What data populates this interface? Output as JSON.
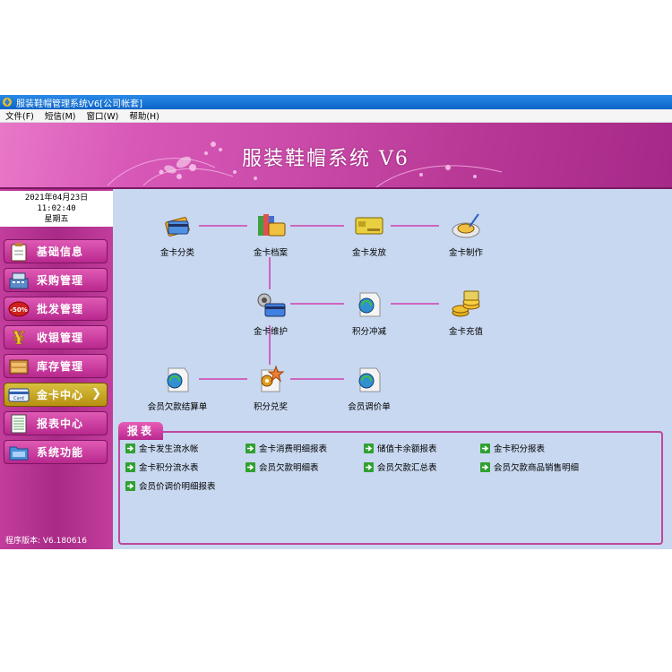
{
  "window": {
    "title": "服装鞋帽管理系统V6[公司帐套]"
  },
  "menu": [
    "文件(F)",
    "短信(M)",
    "窗口(W)",
    "帮助(H)"
  ],
  "banner": {
    "title": "服装鞋帽系统 V6"
  },
  "clock": {
    "date": "2021年04月23日",
    "time": "11:02:40",
    "weekday": "星期五"
  },
  "nav": [
    {
      "label": "基础信息",
      "icon": "clipboard-icon"
    },
    {
      "label": "采购管理",
      "icon": "cash-register-icon"
    },
    {
      "label": "批发管理",
      "icon": "discount-tag-icon",
      "badge": "-50%"
    },
    {
      "label": "收银管理",
      "icon": "yen-icon"
    },
    {
      "label": "库存管理",
      "icon": "inventory-icon"
    },
    {
      "label": "金卡中心",
      "icon": "card-icon",
      "badge": "Card",
      "active": true
    },
    {
      "label": "报表中心",
      "icon": "report-icon"
    },
    {
      "label": "系统功能",
      "icon": "folder-icon"
    }
  ],
  "version": "程序版本: V6.180616",
  "flow": {
    "nodes": [
      {
        "label": "金卡分类",
        "icon": "card-category-icon"
      },
      {
        "label": "金卡档案",
        "icon": "card-archive-icon"
      },
      {
        "label": "金卡发放",
        "icon": "card-issue-icon"
      },
      {
        "label": "金卡制作",
        "icon": "card-make-icon"
      },
      {
        "label": "金卡维护",
        "icon": "card-maintain-icon"
      },
      {
        "label": "积分冲减",
        "icon": "points-deduct-icon"
      },
      {
        "label": "金卡充值",
        "icon": "card-recharge-icon"
      },
      {
        "label": "会员欠款结算单",
        "icon": "member-settle-icon"
      },
      {
        "label": "积分兑奖",
        "icon": "points-redeem-icon"
      },
      {
        "label": "会员调价单",
        "icon": "member-price-icon"
      }
    ]
  },
  "reports": {
    "tab": "报表",
    "links": [
      "金卡发生流水帐",
      "金卡消费明细报表",
      "储值卡余额报表",
      "金卡积分报表",
      "金卡积分流水表",
      "会员欠款明细表",
      "会员欠款汇总表",
      "会员欠款商品销售明细",
      "会员价调价明细报表"
    ]
  },
  "colors": {
    "accent": "#c23d9c",
    "panel": "#c8d8f0",
    "active_nav": "#c8a020"
  }
}
